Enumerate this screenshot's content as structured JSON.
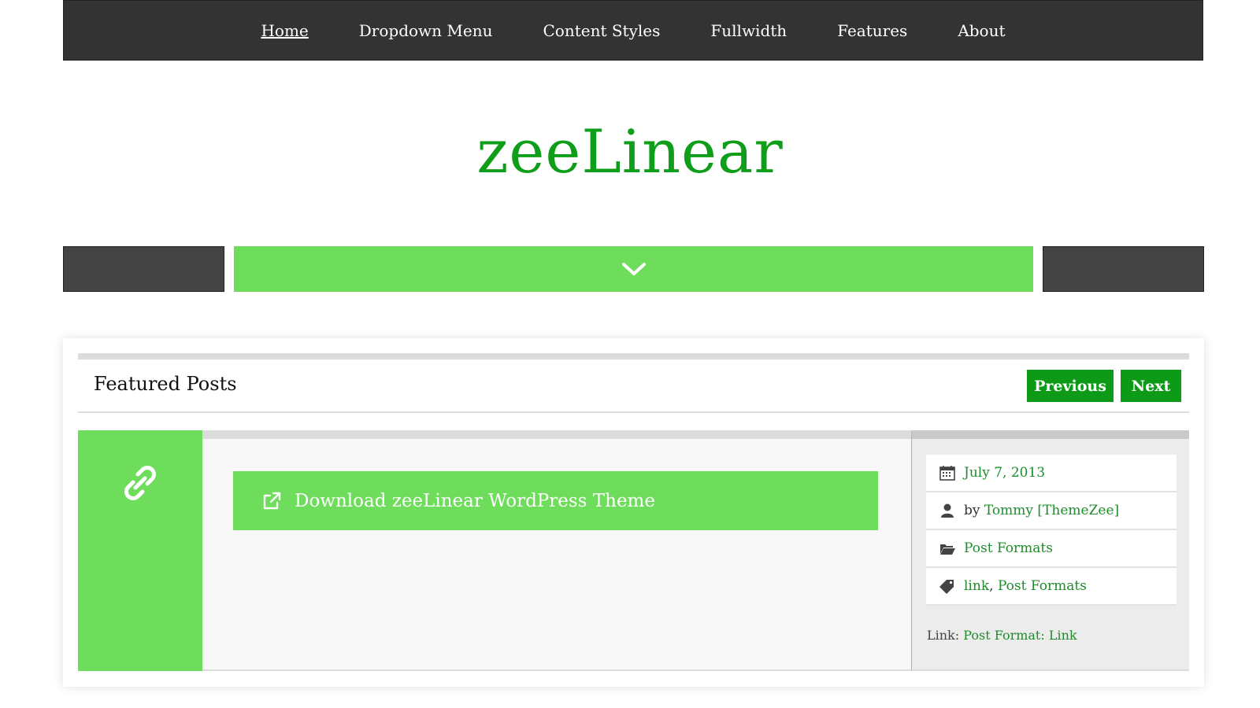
{
  "nav": {
    "items": [
      {
        "label": "Home",
        "active": true
      },
      {
        "label": "Dropdown Menu"
      },
      {
        "label": "Content Styles"
      },
      {
        "label": "Fullwidth"
      },
      {
        "label": "Features"
      },
      {
        "label": "About"
      }
    ]
  },
  "site": {
    "title": "zeeLinear",
    "accent_color": "#0f9e1a",
    "light_accent_color": "#6edd5b"
  },
  "toggle": {
    "icon": "chevron-down-icon"
  },
  "featured": {
    "title": "Featured Posts",
    "prev_label": "Previous",
    "next_label": "Next",
    "post": {
      "format_icon": "link-icon",
      "link_text": "Download zeeLinear WordPress Theme",
      "link_icon": "external-link-icon",
      "date": "July 7, 2013",
      "by_prefix": "by",
      "author": "Tommy [ThemeZee]",
      "category": "Post Formats",
      "tag_1": "link",
      "tag_sep": ",",
      "tag_2": "Post Formats",
      "foot_prefix": "Link:",
      "foot_link": "Post Format: Link"
    }
  }
}
